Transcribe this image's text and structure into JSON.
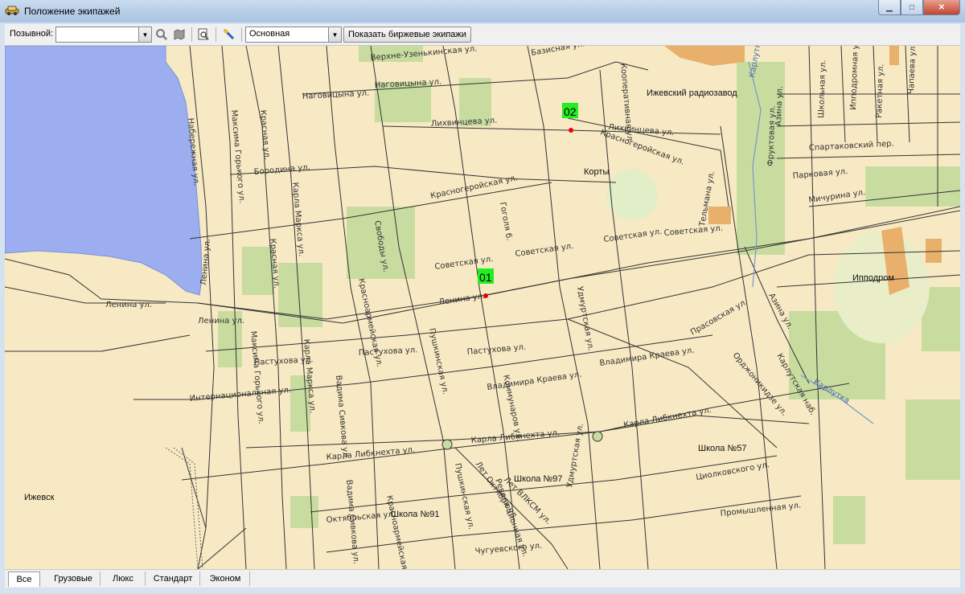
{
  "window": {
    "title": "Положение экипажей"
  },
  "toolbar": {
    "callsign_label": "Позывной:",
    "callsign_value": "",
    "layer_value": "Основная",
    "exchange_button": "Показать биржевые экипажи"
  },
  "map": {
    "places": [
      "Ижевский радиозавод",
      "Корты",
      "Ипподром",
      "Ижевск",
      "Школа №57",
      "Школа №97",
      "Школа №91"
    ],
    "rivers": [
      "Карлутка",
      "Карлутка"
    ],
    "streets": [
      "Базисная ул.",
      "Верхне-Узенькинская ул.",
      "Наговицына ул.",
      "Наговицына ул.",
      "Лихвинцева ул.",
      "Лихвинцева ул.",
      "Красногеройская ул.",
      "Красногеройская ул.",
      "Бородина ул.",
      "Советская ул.",
      "Советская ул.",
      "Советская ул.",
      "Советская ул.",
      "Ленина ул.",
      "Ленина ул.",
      "Пастухова ул.",
      "Пастухова ул.",
      "Пастухова ул.",
      "Владимира Краева ул.",
      "Владимира Краева ул.",
      "Карла Либкнехта ул.",
      "Карла Либкнехта ул.",
      "Карла Либкнехта ул.",
      "Интернациональная ул.",
      "Октябрьская ул.",
      "Чугуевского ул.",
      "Промышленная ул.",
      "Циолковского ул.",
      "Удмуртская ул.",
      "Удмуртская ул.",
      "Пушкинская ул.",
      "Пушкинская ул.",
      "Коммунаров ул.",
      "Красноармейская ул.",
      "Красноармейская ул.",
      "Красная ул.",
      "Красная ул.",
      "Карла Маркса ул.",
      "Карла Маркса ул.",
      "Максима Горького ул.",
      "Максима Горького ул.",
      "Свободы ул.",
      "Гоголя б.",
      "Кооперативная ул.",
      "Тельмана ул.",
      "Спартаковский пер.",
      "Парковая ул.",
      "Мичурина ул.",
      "Фруктовая ул.",
      "Азина ул.",
      "Ипподромная ул.",
      "Школьная ул.",
      "Чапаева ул.",
      "Ракетная ул.",
      "Прасовская ул.",
      "Орджоникидзе ул.",
      "Карлутская наб.",
      "Азина ул.",
      "Набережная ул.",
      "Ленина ул.",
      "Ленина ул.",
      "Вадима Сивкова ул.",
      "Вадима Сивкова ул.",
      "Революционная ул.",
      "Лет Октября ул.",
      "Лет ВЛКСМ ул."
    ],
    "cabs": [
      {
        "id": "01"
      },
      {
        "id": "02"
      }
    ]
  },
  "tabs": [
    "Все",
    "Грузовые",
    "Люкс",
    "Стандарт",
    "Эконом"
  ]
}
